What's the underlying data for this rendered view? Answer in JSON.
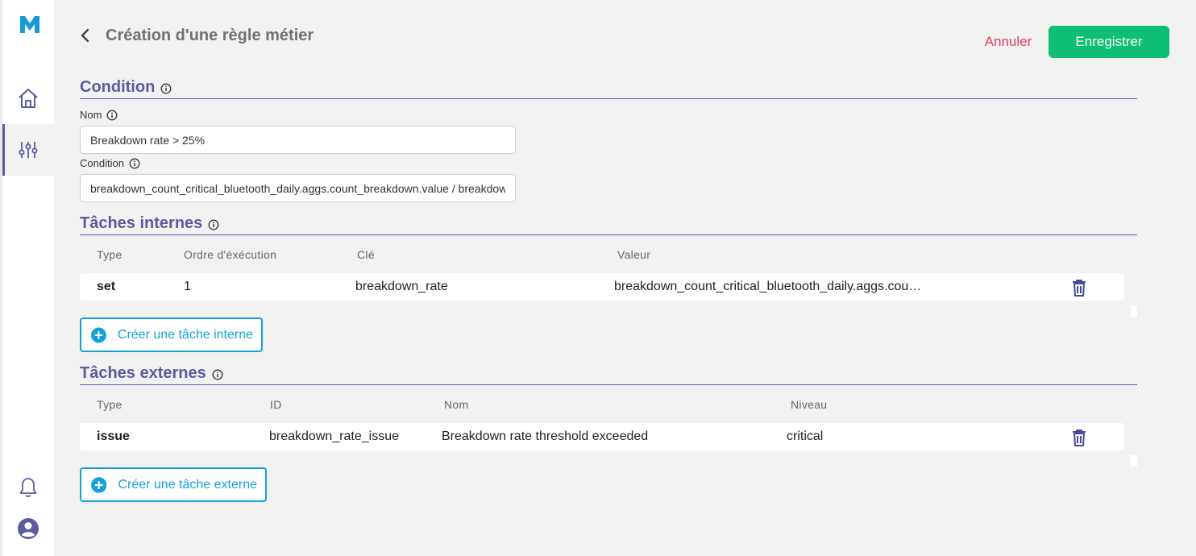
{
  "brand": {
    "logo_letter": "M",
    "color": "#1a9ad6"
  },
  "sidebar": {
    "items": [
      {
        "name": "home",
        "icon": "home-icon"
      },
      {
        "name": "rules",
        "icon": "sliders-icon",
        "active": true
      },
      {
        "name": "notifications",
        "icon": "bell-icon"
      },
      {
        "name": "profile",
        "icon": "user-circle-icon"
      }
    ],
    "accent": "#5c5a9f"
  },
  "header": {
    "title": "Création d'une règle métier",
    "cancel_label": "Annuler",
    "save_label": "Enregistrer"
  },
  "condition_section": {
    "title": "Condition",
    "name_label": "Nom",
    "name_value": "Breakdown rate > 25%",
    "condition_label": "Condition",
    "condition_value": "breakdown_count_critical_bluetooth_daily.aggs.count_breakdown.value / breakdown_count_critical_bluetooth_daily.aggs"
  },
  "internal_tasks": {
    "title": "Tâches internes",
    "columns": [
      "Type",
      "Ordre d'éxécution",
      "Clé",
      "Valeur"
    ],
    "rows": [
      {
        "type": "set",
        "order": "1",
        "key": "breakdown_rate",
        "value": "breakdown_count_critical_bluetooth_daily.aggs.cou…"
      }
    ],
    "create_label": "Créer une tâche interne"
  },
  "external_tasks": {
    "title": "Tâches externes",
    "columns": [
      "Type",
      "ID",
      "Nom",
      "Niveau"
    ],
    "rows": [
      {
        "type": "issue",
        "id": "breakdown_rate_issue",
        "name": "Breakdown rate threshold exceeded",
        "level": "critical"
      }
    ],
    "create_label": "Créer une tâche externe"
  },
  "colors": {
    "primary_purple": "#5c5a9f",
    "save_green": "#0dbe74",
    "cancel_red": "#e0405a",
    "create_blue": "#13a2d7"
  }
}
